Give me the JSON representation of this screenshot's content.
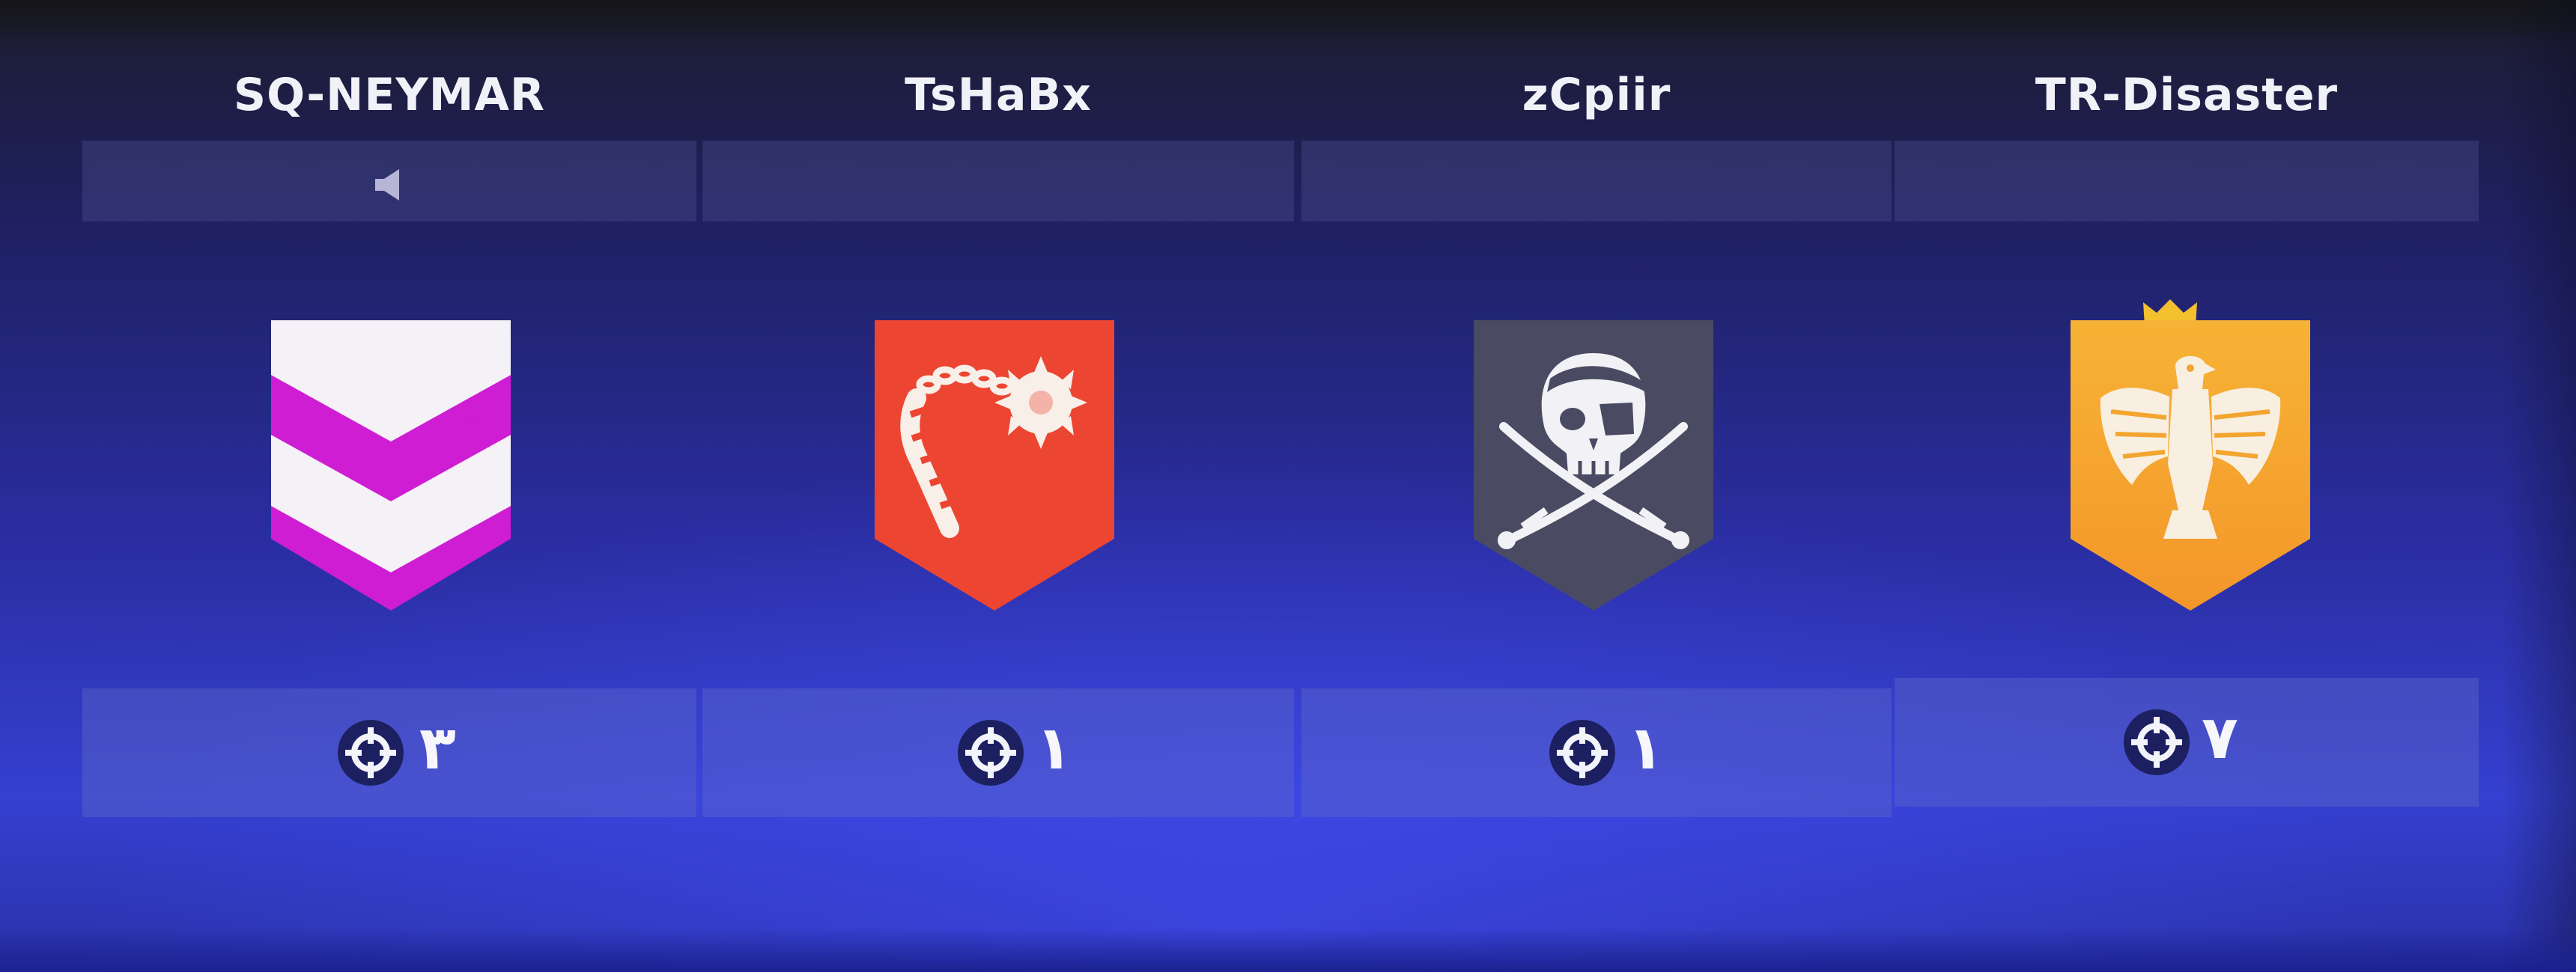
{
  "players": [
    {
      "name": "SQ-NEYMAR",
      "voice_icon": "speaker-icon",
      "badge_icon": "chevron-rank-icon",
      "badge_color": "#d21fd6",
      "kills_icon": "crosshair-icon",
      "kills": "٣"
    },
    {
      "name": "TsHaBx",
      "badge_icon": "flail-icon",
      "badge_color": "#ee4a34",
      "kills_icon": "crosshair-icon",
      "kills": "١"
    },
    {
      "name": "zCpiir",
      "badge_icon": "pirate-skull-icon",
      "badge_color": "#4b4c64",
      "kills_icon": "crosshair-icon",
      "kills": "١"
    },
    {
      "name": "TR-Disaster",
      "leader_icon": "crown-icon",
      "badge_icon": "eagle-icon",
      "badge_color": "#f6a92e",
      "kills_icon": "crosshair-icon",
      "kills": "٧"
    }
  ]
}
